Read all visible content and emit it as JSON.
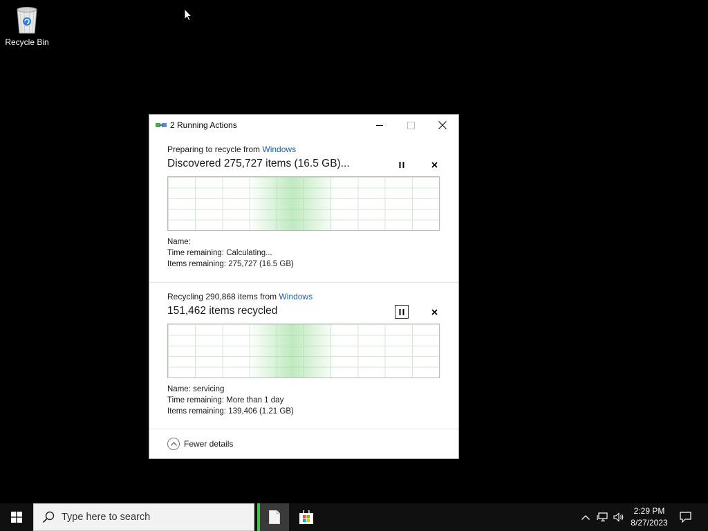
{
  "desktop": {
    "recycle_bin_label": "Recycle Bin"
  },
  "dialog": {
    "title": "2 Running Actions",
    "operations": [
      {
        "head_prefix": "Preparing to recycle from ",
        "head_link": "Windows",
        "status": "Discovered 275,727 items (16.5 GB)...",
        "name": "Name:",
        "time_remaining": "Time remaining:  Calculating...",
        "items_remaining": "Items remaining:  275,727 (16.5 GB)"
      },
      {
        "head_prefix": "Recycling 290,868 items from ",
        "head_link": "Windows",
        "status": "151,462 items recycled",
        "name": "Name:  servicing",
        "time_remaining": "Time remaining:  More than 1 day",
        "items_remaining": "Items remaining:  139,406 (1.21 GB)"
      }
    ],
    "fewer_details_label": "Fewer details"
  },
  "taskbar": {
    "search_placeholder": "Type here to search",
    "clock_time": "2:29 PM",
    "clock_date": "8/27/2023",
    "accent_color": "#46c34a"
  },
  "icons": [
    "recycle-bin-icon",
    "windows-start-icon",
    "search-icon",
    "file-explorer-icon",
    "microsoft-store-icon",
    "chevron-up-icon",
    "network-icon",
    "volume-icon",
    "notification-icon",
    "pause-icon",
    "cancel-icon",
    "minimize-icon",
    "maximize-icon",
    "close-icon"
  ]
}
